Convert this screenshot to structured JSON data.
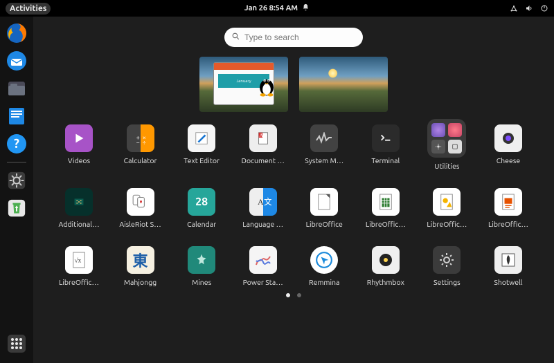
{
  "topbar": {
    "activities_label": "Activities",
    "date_time": "Jan 26  8:54 AM"
  },
  "search": {
    "placeholder": "Type to search"
  },
  "dock": [
    {
      "name": "firefox"
    },
    {
      "name": "thunderbird"
    },
    {
      "name": "files"
    },
    {
      "name": "libreoffice-writer"
    },
    {
      "name": "help"
    }
  ],
  "workspaces": [
    {
      "label_on_window": "January"
    }
  ],
  "apps": [
    {
      "id": "videos",
      "label": "Videos"
    },
    {
      "id": "calculator",
      "label": "Calculator"
    },
    {
      "id": "text-editor",
      "label": "Text Editor"
    },
    {
      "id": "document-viewer",
      "label": "Document …"
    },
    {
      "id": "system-monitor",
      "label": "System M…"
    },
    {
      "id": "terminal",
      "label": "Terminal"
    },
    {
      "id": "utilities",
      "label": "Utilities"
    },
    {
      "id": "cheese",
      "label": "Cheese"
    },
    {
      "id": "additional-drivers",
      "label": "Additional…"
    },
    {
      "id": "aisleriot",
      "label": "AisleRiot S…"
    },
    {
      "id": "calendar",
      "label": "Calendar"
    },
    {
      "id": "language-support",
      "label": "Language …"
    },
    {
      "id": "libreoffice",
      "label": "LibreOffice"
    },
    {
      "id": "libreoffice-calc",
      "label": "LibreOffic…"
    },
    {
      "id": "libreoffice-draw",
      "label": "LibreOffic…"
    },
    {
      "id": "libreoffice-impress",
      "label": "LibreOffic…"
    },
    {
      "id": "libreoffice-math",
      "label": "LibreOffic…"
    },
    {
      "id": "mahjongg",
      "label": "Mahjongg"
    },
    {
      "id": "mines",
      "label": "Mines"
    },
    {
      "id": "power-statistics",
      "label": "Power Sta…"
    },
    {
      "id": "remmina",
      "label": "Remmina"
    },
    {
      "id": "rhythmbox",
      "label": "Rhythmbox"
    },
    {
      "id": "settings",
      "label": "Settings"
    },
    {
      "id": "shotwell",
      "label": "Shotwell"
    }
  ],
  "calendar_day": "28",
  "pager": {
    "pages": 2,
    "active": 1
  }
}
